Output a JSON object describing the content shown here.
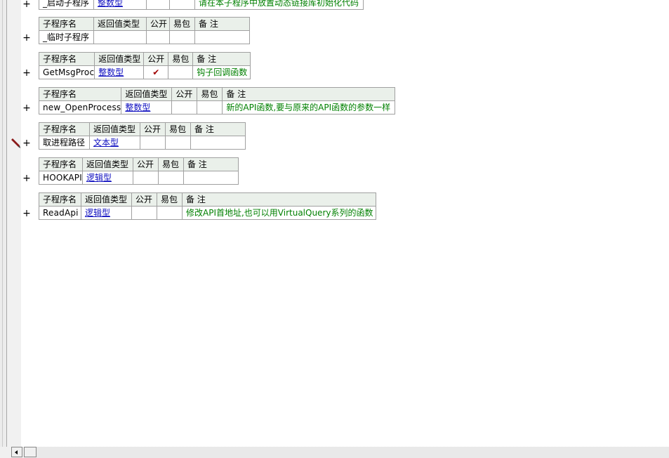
{
  "headers": {
    "name": "子程序名",
    "ret": "返回值类型",
    "public": "公开",
    "easy": "易包",
    "remark": "备 注"
  },
  "expand_symbol": "+",
  "subs": [
    {
      "name": "_启动子程序",
      "type": "整数型",
      "public": "",
      "easy": "",
      "remark": "请在本子程序中放置动态链接库初始化代码"
    },
    {
      "name": "_临时子程序",
      "type": "",
      "public": "",
      "easy": "",
      "remark": ""
    },
    {
      "name": "GetMsgProc",
      "type": "整数型",
      "public": "✔",
      "easy": "",
      "remark": "钩子回调函数"
    },
    {
      "name": "new_OpenProcess",
      "type": "整数型",
      "public": "",
      "easy": "",
      "remark": "新的API函数,要与原来的API函数的参数一样"
    },
    {
      "name": "取进程路径",
      "type": "文本型",
      "public": "",
      "easy": "",
      "remark": ""
    },
    {
      "name": "HOOKAPI",
      "type": "逻辑型",
      "public": "",
      "easy": "",
      "remark": ""
    },
    {
      "name": "ReadApi",
      "type": "逻辑型",
      "public": "",
      "easy": "",
      "remark": "修改API首地址,也可以用VirtualQuery系列的函数"
    }
  ],
  "colors": {
    "header_bg": "#eaf0ea",
    "remark": "#008000",
    "type_link": "#1010c0",
    "check": "#a00000"
  }
}
